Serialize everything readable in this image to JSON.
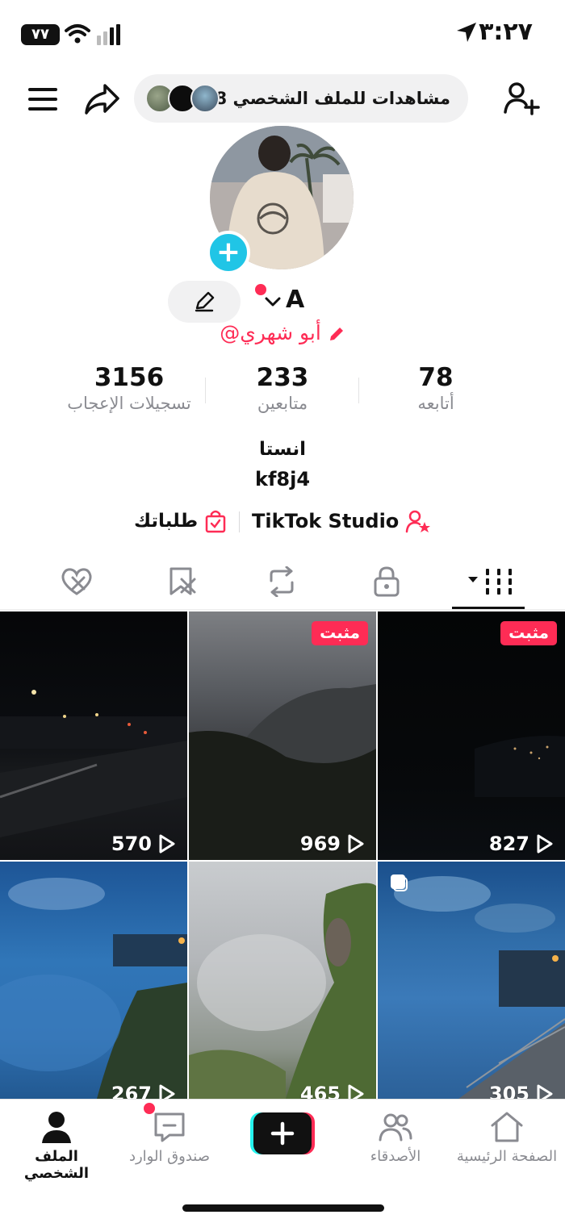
{
  "status_bar": {
    "time": "٣:٢٧",
    "battery": "٧٧"
  },
  "top_bar": {
    "profile_views": "8 مشاهدات للملف الشخصي"
  },
  "profile": {
    "display_name": "A",
    "username": "@أبو شهري",
    "bio_line1": "انستا",
    "bio_line2": "kf8j4",
    "studio_label": "TikTok Studio",
    "orders_label": "طلباتك"
  },
  "stats": {
    "likes": {
      "value": "3156",
      "label": "تسجيلات الإعجاب"
    },
    "followers": {
      "value": "233",
      "label": "متابعين"
    },
    "following": {
      "value": "78",
      "label": "أتابعه"
    }
  },
  "videos": [
    {
      "views": "827",
      "pinned_label": "مثبت"
    },
    {
      "views": "969",
      "pinned_label": "مثبت"
    },
    {
      "views": "570"
    },
    {
      "views": "305"
    },
    {
      "views": "465"
    },
    {
      "views": "267"
    }
  ],
  "bottom_nav": {
    "home": "الصفحة الرئيسية",
    "friends": "الأصدقاء",
    "inbox": "صندوق الوارد",
    "profile": "الملف الشخصي"
  },
  "colors": {
    "accent": "#fe2c55",
    "badge_blue": "#20c5e6"
  }
}
